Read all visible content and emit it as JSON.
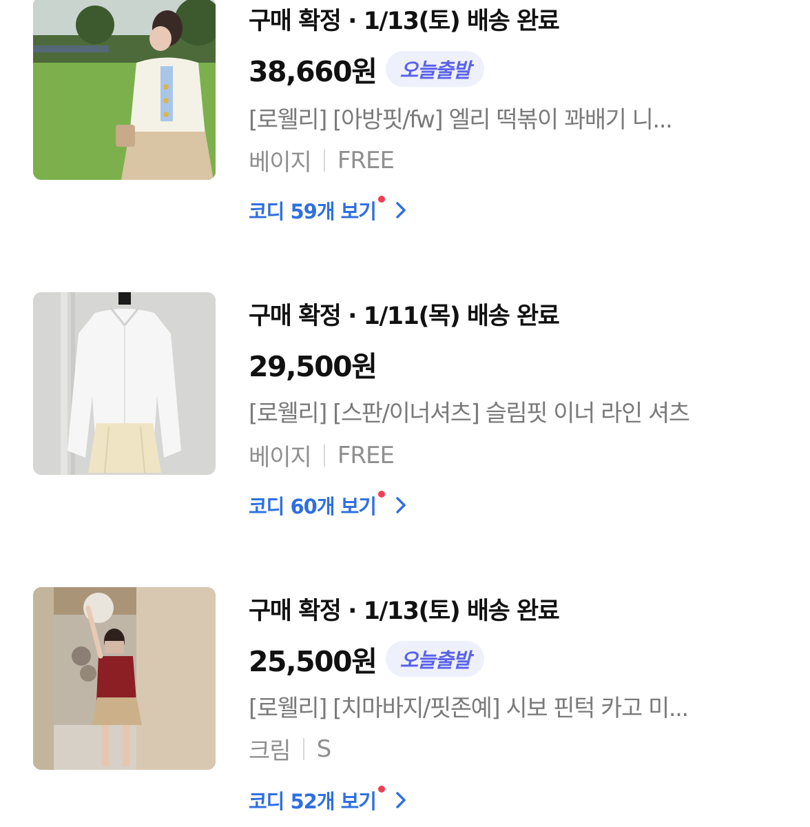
{
  "orders": [
    {
      "status": "구매 확정 · 1/13(토) 배송 완료",
      "price": "38,660원",
      "badge": "오늘출발",
      "product_name": "[로웰리] [아방핏/fw] 엘리 떡볶이 꽈배기 니...",
      "color": "베이지",
      "size": "FREE",
      "coordi_link": "코디 59개 보기",
      "thumbnail_icon": "cardigan-outfit-photo"
    },
    {
      "status": "구매 확정 · 1/11(목) 배송 완료",
      "price": "29,500원",
      "badge": "",
      "product_name": "[로웰리] [스판/이너셔츠] 슬림핏 이너 라인 셔츠",
      "color": "베이지",
      "size": "FREE",
      "coordi_link": "코디 60개 보기",
      "thumbnail_icon": "white-shirt-mannequin-photo"
    },
    {
      "status": "구매 확정 · 1/13(토) 배송 완료",
      "price": "25,500원",
      "badge": "오늘출발",
      "product_name": "[로웰리] [치마바지/핏존예] 시보 핀턱 카고 미...",
      "color": "크림",
      "size": "S",
      "coordi_link": "코디 52개 보기",
      "thumbnail_icon": "skirt-outfit-photo"
    }
  ],
  "colors": {
    "badge_bg": "#eef1fb",
    "badge_text": "#5b62ea",
    "link": "#2f6fe0",
    "new_dot": "#ef3f55",
    "muted_text": "#7a7a7a"
  }
}
